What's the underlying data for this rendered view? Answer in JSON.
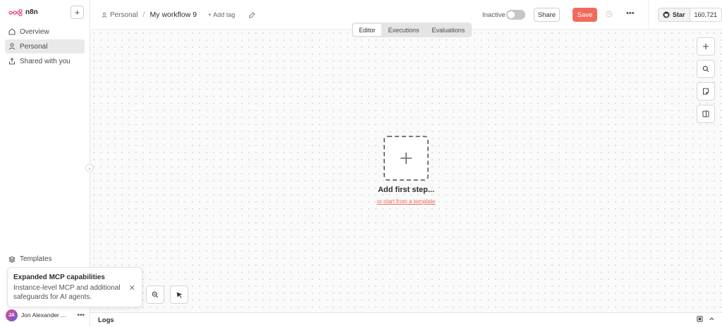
{
  "app": {
    "logo_text": "n8n"
  },
  "sidebar": {
    "items": [
      {
        "label": "Overview",
        "icon": "home-icon",
        "active": false
      },
      {
        "label": "Personal",
        "icon": "user-icon",
        "active": true
      },
      {
        "label": "Shared with you",
        "icon": "share-icon",
        "active": false
      }
    ],
    "templates_label": "Templates",
    "user_name": "Jon Alexander ...",
    "user_initials": "JA"
  },
  "toast": {
    "title": "Expanded MCP capabilities",
    "body": "Instance-level MCP and additional safeguards for AI agents."
  },
  "header": {
    "project": "Personal",
    "workflow_name": "My workflow 9",
    "add_tag": "+ Add tag",
    "status_label": "Inactive",
    "share_label": "Share",
    "save_label": "Save",
    "github_star_label": "Star",
    "github_star_count": "160,721"
  },
  "tabs": [
    {
      "label": "Editor",
      "active": true
    },
    {
      "label": "Executions",
      "active": false
    },
    {
      "label": "Evaluations",
      "active": false
    }
  ],
  "canvas": {
    "add_first_step": "Add first step...",
    "template_link": "or start from a template"
  },
  "logs": {
    "label": "Logs"
  },
  "colors": {
    "accent": "#ef6b5b",
    "canvas_bg": "#fafafa"
  }
}
